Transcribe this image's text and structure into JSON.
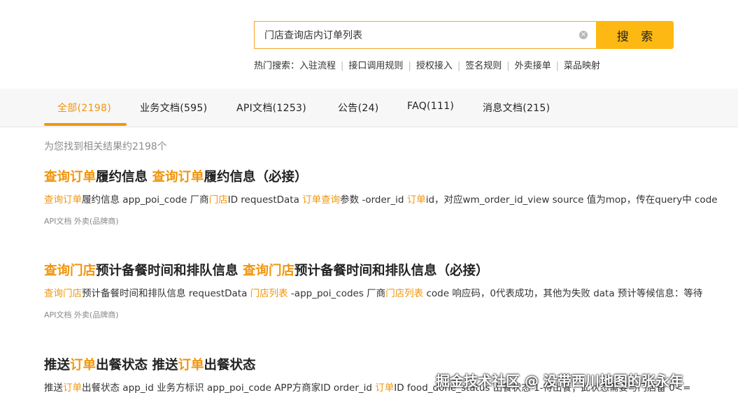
{
  "search": {
    "value": "门店查询店内订单列表",
    "button_label": "搜 索"
  },
  "hot": {
    "label": "热门搜索：",
    "items": [
      "入驻流程",
      "接口调用规则",
      "授权接入",
      "签名规则",
      "外卖接单",
      "菜品映射"
    ]
  },
  "tabs": [
    {
      "label": "全部(2198)"
    },
    {
      "label": "业务文档(595)"
    },
    {
      "label": "API文档(1253)"
    },
    {
      "label": "公告(24)"
    },
    {
      "label": "FAQ(111)"
    },
    {
      "label": "消息文档(215)"
    }
  ],
  "count_text": "为您找到相关结果约2198个",
  "results": [
    {
      "title": [
        {
          "t": "查询订单",
          "hl": true
        },
        {
          "t": "履约信息 ",
          "hl": false
        },
        {
          "t": "查询订单",
          "hl": true
        },
        {
          "t": "履约信息（必接）",
          "hl": false
        }
      ],
      "snippet": [
        {
          "t": "查询订单",
          "hl": true
        },
        {
          "t": "履约信息 app_poi_code 厂商",
          "hl": false
        },
        {
          "t": "门店",
          "hl": true
        },
        {
          "t": "ID requestData ",
          "hl": false
        },
        {
          "t": "订单查询",
          "hl": true
        },
        {
          "t": "参数 -order_id ",
          "hl": false
        },
        {
          "t": "订单",
          "hl": true
        },
        {
          "t": "id，对应wm_order_id_view source 值为mop，传在query中 code",
          "hl": false
        }
      ],
      "meta": "API文档  外卖(品牌商)"
    },
    {
      "title": [
        {
          "t": "查询门店",
          "hl": true
        },
        {
          "t": "预计备餐时间和排队信息 ",
          "hl": false
        },
        {
          "t": "查询门店",
          "hl": true
        },
        {
          "t": "预计备餐时间和排队信息（必接）",
          "hl": false
        }
      ],
      "snippet": [
        {
          "t": "查询门店",
          "hl": true
        },
        {
          "t": "预计备餐时间和排队信息 requestData ",
          "hl": false
        },
        {
          "t": "门店列表",
          "hl": true
        },
        {
          "t": " -app_poi_codes 厂商",
          "hl": false
        },
        {
          "t": "门店列表",
          "hl": true
        },
        {
          "t": " code 响应码，0代表成功，其他为失败 data 预计等候信息：等待",
          "hl": false
        }
      ],
      "meta": "API文档  外卖(品牌商)"
    },
    {
      "title": [
        {
          "t": "推送",
          "hl": false
        },
        {
          "t": "订单",
          "hl": true
        },
        {
          "t": "出餐状态 推送",
          "hl": false
        },
        {
          "t": "订单",
          "hl": true
        },
        {
          "t": "出餐状态",
          "hl": false
        }
      ],
      "snippet": [
        {
          "t": "推送",
          "hl": false
        },
        {
          "t": "订单",
          "hl": true
        },
        {
          "t": "出餐状态 app_id 业务方标识 app_poi_code APP方商家ID order_id ",
          "hl": false
        },
        {
          "t": "订单",
          "hl": true
        },
        {
          "t": "ID food_done_status 出餐状态 1-待出餐；此状态需要与门店备 0<=",
          "hl": false
        }
      ],
      "meta": ""
    }
  ],
  "watermark": "掘金技术社区 @ 没带西川地图的张永年",
  "colors": {
    "accent": "#f0960e",
    "button": "#fdb813"
  }
}
